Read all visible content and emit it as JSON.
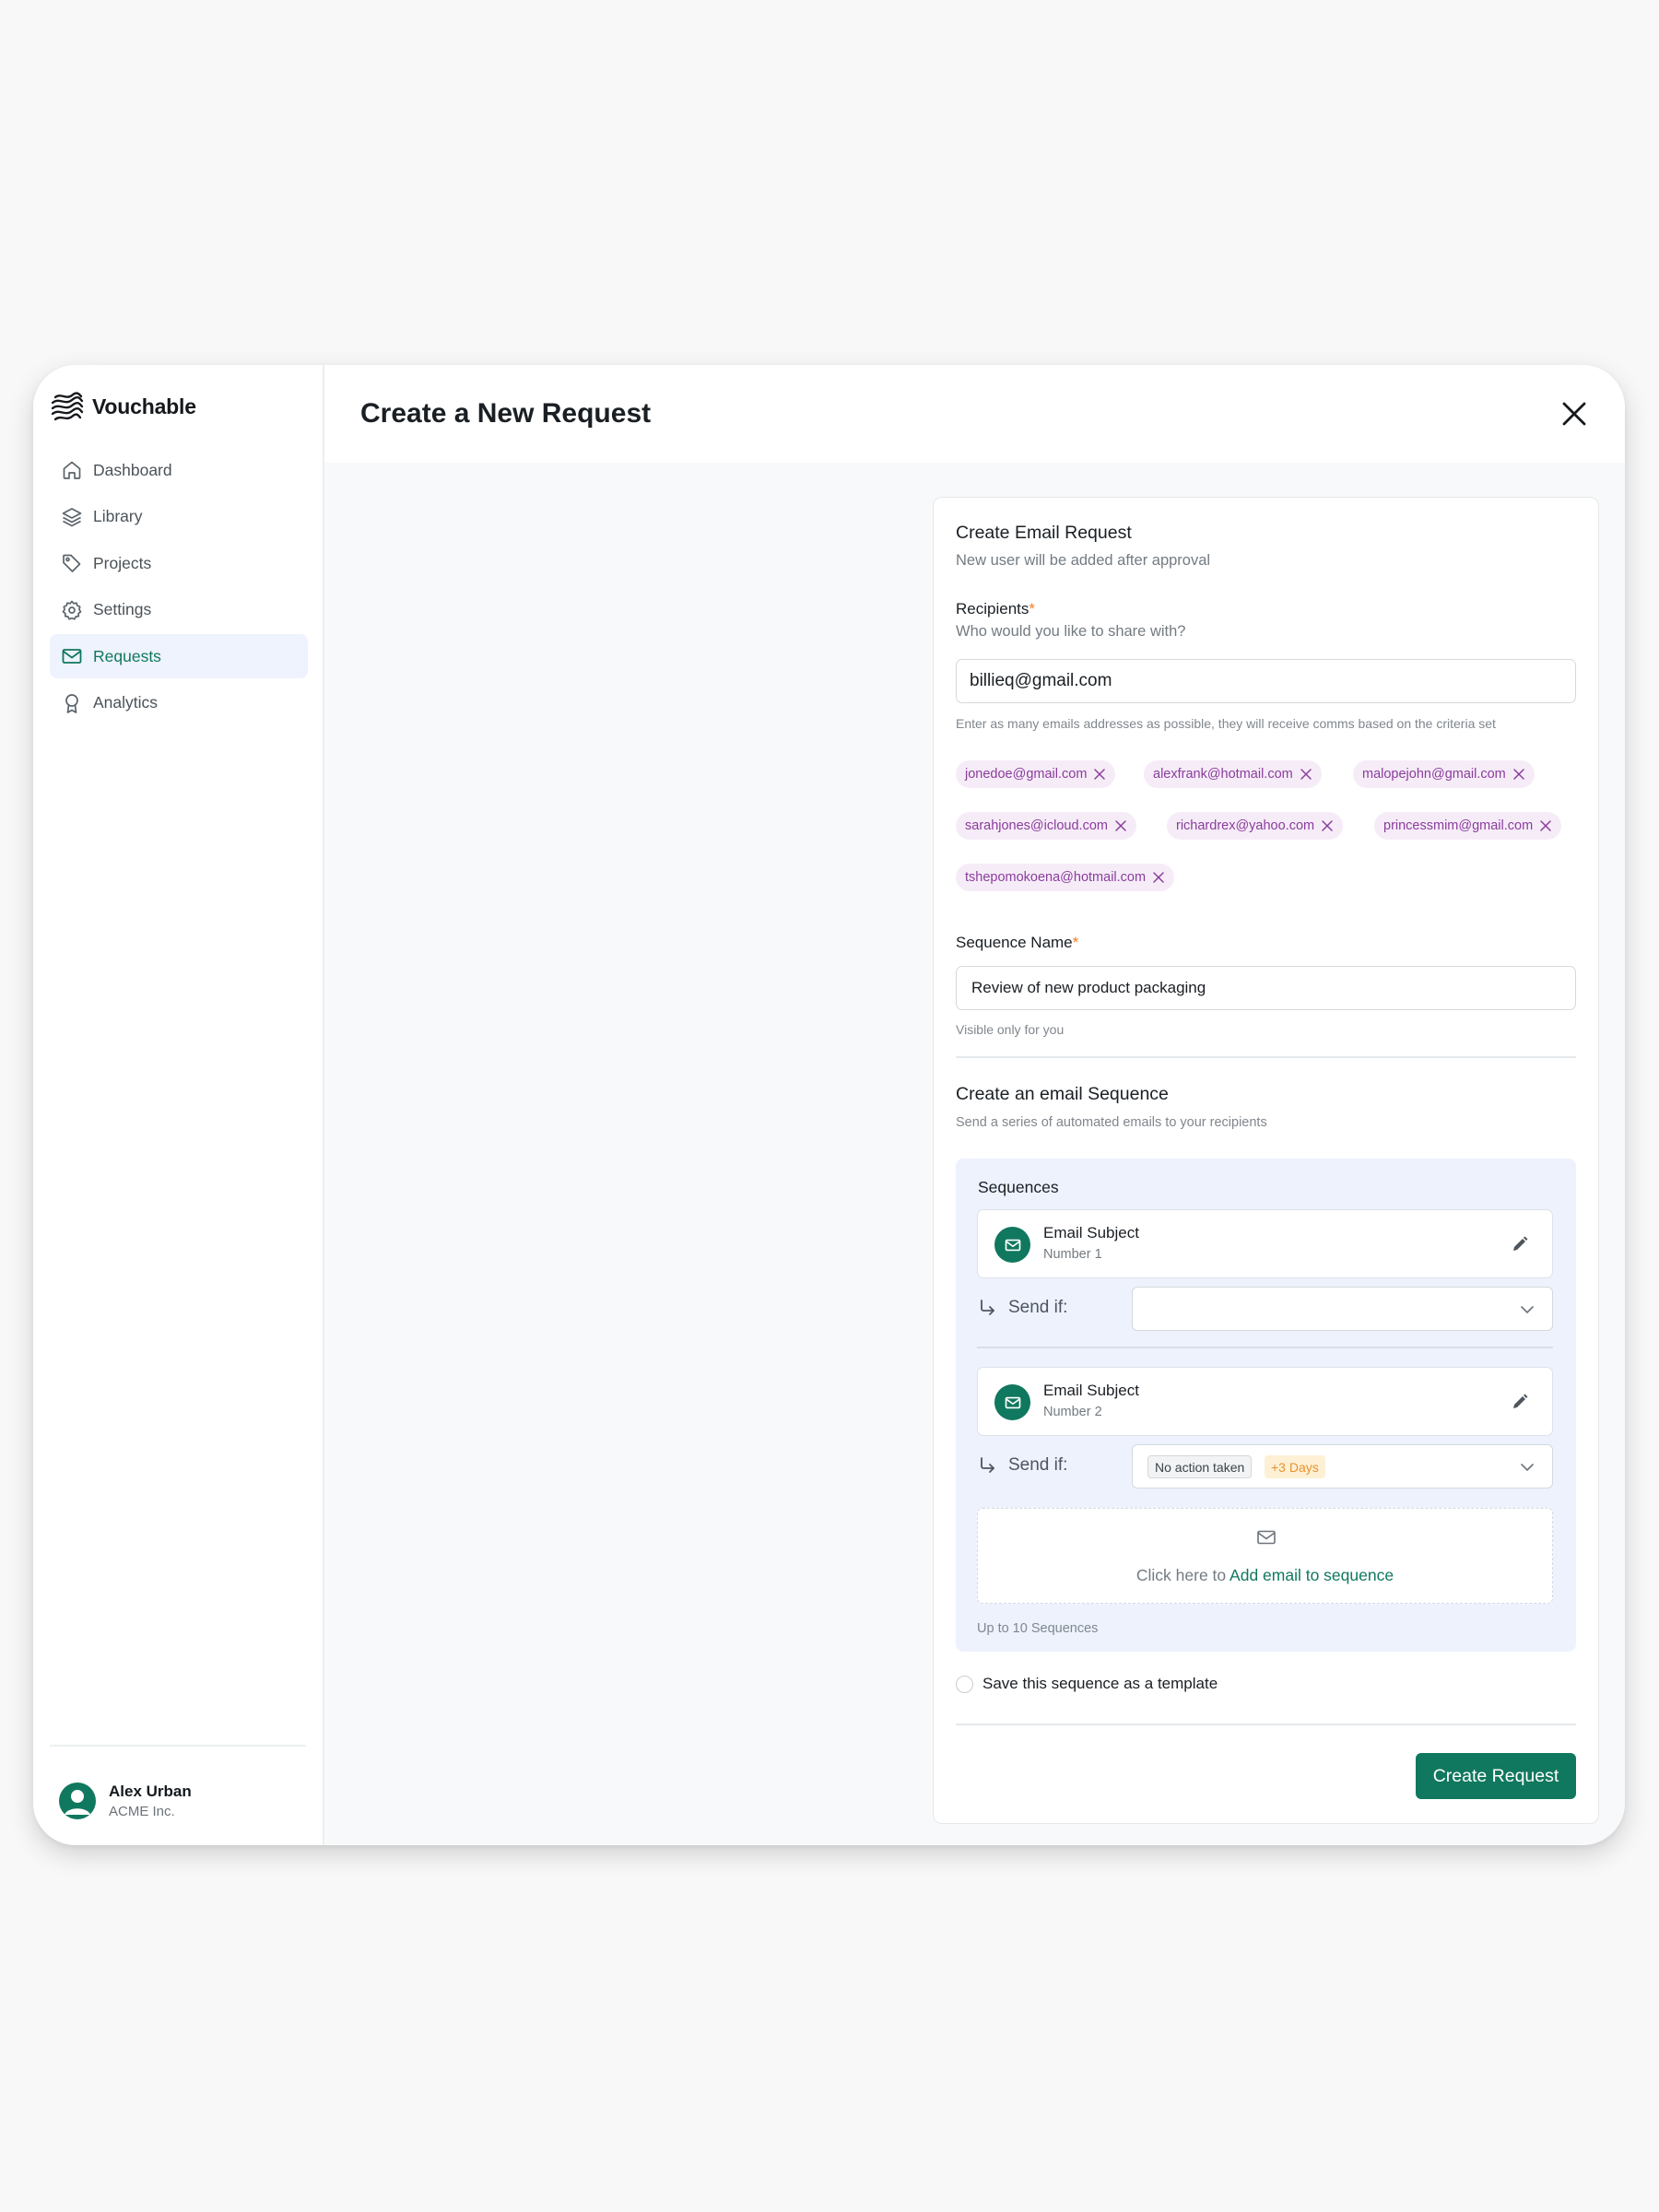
{
  "app": {
    "brand": "Vouchable",
    "nav": [
      {
        "label": "Dashboard",
        "icon": "home-icon"
      },
      {
        "label": "Library",
        "icon": "layers-icon"
      },
      {
        "label": "Projects",
        "icon": "tag-icon"
      },
      {
        "label": "Settings",
        "icon": "gear-icon"
      },
      {
        "label": "Requests",
        "icon": "mail-icon",
        "active": true
      },
      {
        "label": "Analytics",
        "icon": "award-icon"
      }
    ],
    "user": {
      "name": "Alex Urban",
      "org": "ACME Inc."
    },
    "accent_color": "#10785e"
  },
  "header": {
    "title": "Create a New Request"
  },
  "form": {
    "section_title": "Create Email Request",
    "section_sub": "New user will be added after approval",
    "recipients": {
      "label": "Recipients",
      "required_mark": "*",
      "sub": "Who would you like to share with?",
      "value": "billieq@gmail.com",
      "hint": "Enter as many emails addresses as possible, they will receive comms based on the criteria set",
      "chips": [
        "jonedoe@gmail.com",
        "alexfrank@hotmail.com",
        "malopejohn@gmail.com",
        "sarahjones@icloud.com",
        "richardrex@yahoo.com",
        "princessmim@gmail.com",
        "tshepomokoena@hotmail.com"
      ]
    },
    "sequence_name": {
      "label": "Sequence Name",
      "required_mark": "*",
      "value": "Review of new product packaging",
      "hint": "Visible only for you"
    },
    "email_sequence": {
      "title": "Create an email Sequence",
      "sub": "Send a series of automated emails to your recipients",
      "panel_title": "Sequences",
      "items": [
        {
          "subject": "Email Subject",
          "number": "Number 1",
          "send_if_label": "Send if:",
          "condition": "",
          "delay": ""
        },
        {
          "subject": "Email Subject",
          "number": "Number 2",
          "send_if_label": "Send if:",
          "condition": "No action taken",
          "delay": "+3 Days"
        }
      ],
      "add_prefix": "Click here to ",
      "add_link": "Add email to sequence",
      "limit_hint": "Up to 10 Sequences"
    },
    "save_template_label": "Save this sequence as a template",
    "save_template_checked": false,
    "submit_label": "Create Request"
  }
}
